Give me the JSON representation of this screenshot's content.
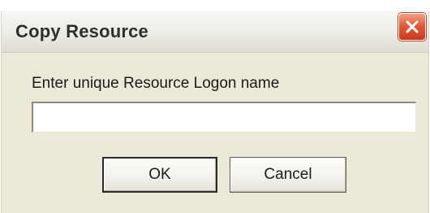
{
  "window": {
    "title": "Copy Resource",
    "close_icon": "close-icon"
  },
  "form": {
    "prompt_label": "Enter unique Resource Logon name",
    "name_value": "",
    "name_placeholder": ""
  },
  "buttons": {
    "ok_label": "OK",
    "cancel_label": "Cancel"
  },
  "colors": {
    "close_button": "#e25c3a",
    "dialog_background": "#ece9d8"
  }
}
